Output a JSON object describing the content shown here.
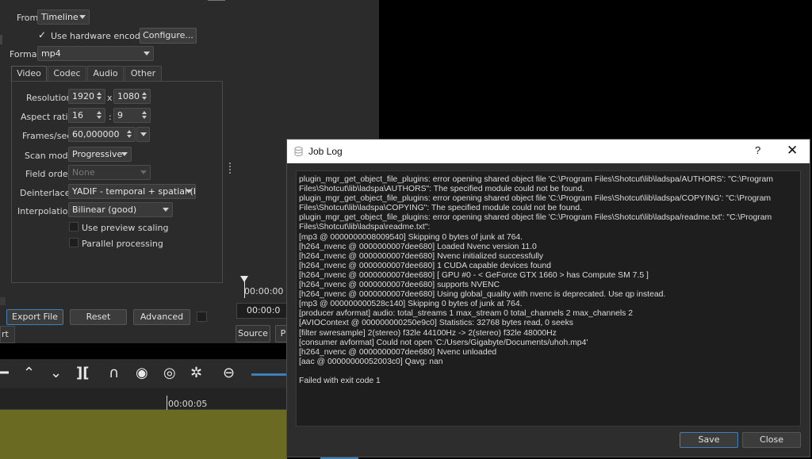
{
  "export": {
    "from_label": "From",
    "from_value": "Timeline",
    "hw_encoder_label": "Use hardware encoder",
    "configure_label": "Configure...",
    "format_label": "Format",
    "format_value": "mp4",
    "tabs": [
      "Video",
      "Codec",
      "Audio",
      "Other"
    ],
    "resolution_label": "Resolution",
    "res_width": "1920",
    "res_x": "x",
    "res_height": "1080",
    "aspect_label": "Aspect ratio",
    "aspect_w": "16",
    "aspect_sep": ":",
    "aspect_h": "9",
    "fps_label": "Frames/sec",
    "fps_value": "60,000000",
    "scan_label": "Scan mode",
    "scan_value": "Progressive",
    "field_label": "Field order",
    "field_value": "None",
    "deint_label": "Deinterlacer",
    "deint_value": "YADIF - temporal + spatial (be",
    "interp_label": "Interpolation",
    "interp_value": "Bilinear (good)",
    "preview_scaling_label": "Use preview scaling",
    "parallel_label": "Parallel processing",
    "export_file_label": "Export File",
    "reset_label": "Reset",
    "advanced_label": "Advanced",
    "left_cut_label": "rt"
  },
  "player": {
    "timecode_top": "00:00:00",
    "timecode_box": "00:00:0",
    "source_tab": "Source",
    "program_tab_cut": "P"
  },
  "timeline": {
    "ruler_time": "00:00:05"
  },
  "job_log": {
    "title": "Job Log",
    "help": "?",
    "close_glyph": "✕",
    "lines": [
      "plugin_mgr_get_object_file_plugins: error opening shared object file 'C:\\Program Files\\Shotcut\\lib\\ladspa/AUTHORS': \"C:\\Program",
      "Files\\Shotcut\\lib\\ladspa\\AUTHORS\": The specified module could not be found.",
      "plugin_mgr_get_object_file_plugins: error opening shared object file 'C:\\Program Files\\Shotcut\\lib\\ladspa/COPYING': \"C:\\Program",
      "Files\\Shotcut\\lib\\ladspa\\COPYING\": The specified module could not be found.",
      "plugin_mgr_get_object_file_plugins: error opening shared object file 'C:\\Program Files\\Shotcut\\lib\\ladspa/readme.txt': \"C:\\Program",
      "Files\\Shotcut\\lib\\ladspa\\readme.txt\":",
      "[mp3 @ 0000000008009540] Skipping 0 bytes of junk at 764.",
      "[h264_nvenc @ 0000000007dee680] Loaded Nvenc version 11.0",
      "[h264_nvenc @ 0000000007dee680] Nvenc initialized successfully",
      "[h264_nvenc @ 0000000007dee680] 1 CUDA capable devices found",
      "[h264_nvenc @ 0000000007dee680] [ GPU #0 - < GeForce GTX 1660 > has Compute SM 7.5 ]",
      "[h264_nvenc @ 0000000007dee680] supports NVENC",
      "[h264_nvenc @ 0000000007dee680] Using global_quality with nvenc is deprecated. Use qp instead.",
      "[mp3 @ 000000000528c140] Skipping 0 bytes of junk at 764.",
      "[producer avformat] audio: total_streams 1 max_stream 0 total_channels 2 max_channels 2",
      "[AVIOContext @ 000000000250e9c0] Statistics: 32768 bytes read, 0 seeks",
      "[filter swresample] 2(stereo) f32le 44100Hz -> 2(stereo) f32le 48000Hz",
      "[consumer avformat] Could not open 'C:/Users/Gigabyte/Documents/uhoh.mp4'",
      "[h264_nvenc @ 0000000007dee680] Nvenc unloaded",
      "[aac @ 00000000052003c0] Qavg: nan"
    ],
    "final_line": "Failed with exit code 1",
    "save_label": "Save",
    "close_label": "Close"
  },
  "colors": {
    "panel_bg": "#2b2b2b",
    "track_color": "#6b6a22",
    "accent_blue": "#3d7fb8"
  }
}
